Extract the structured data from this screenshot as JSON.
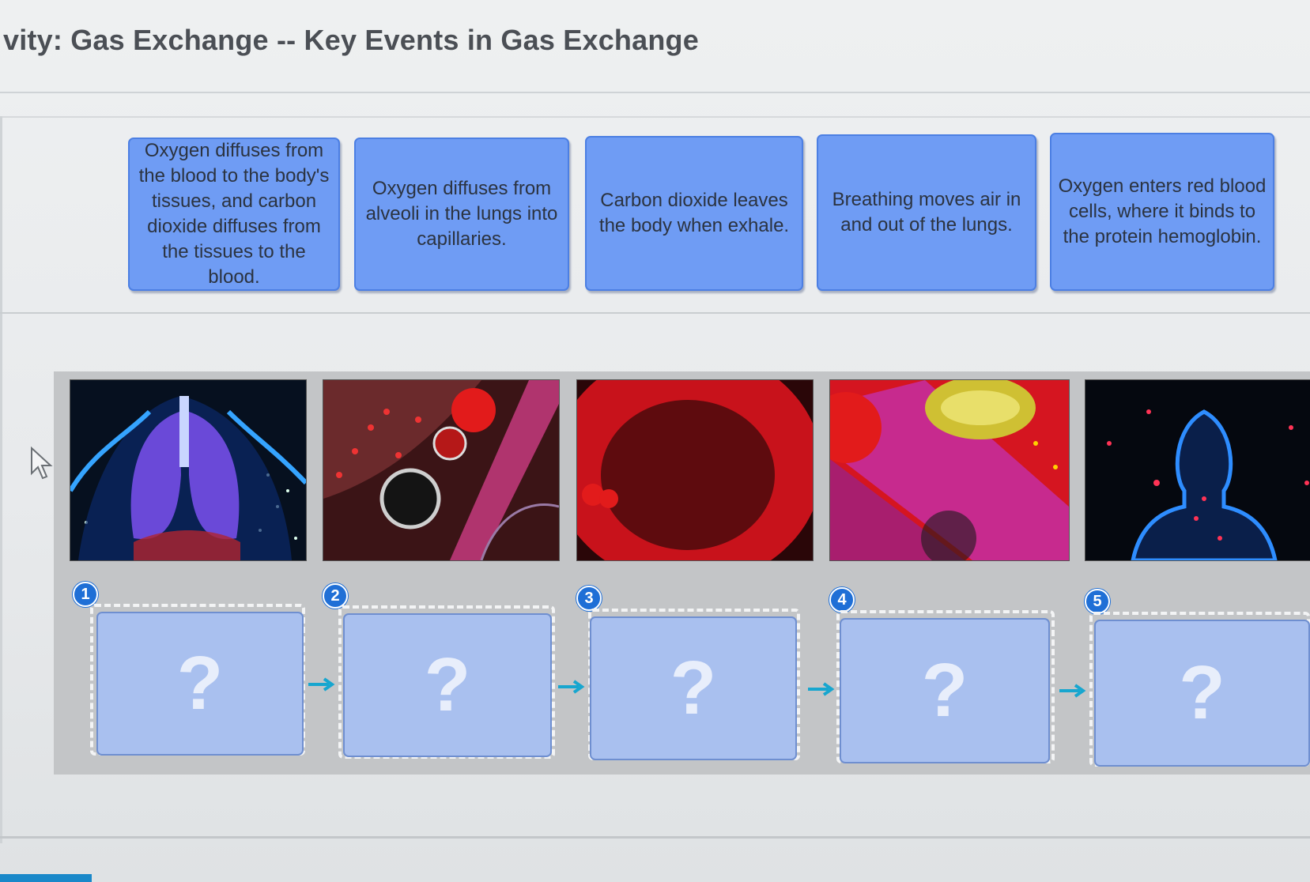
{
  "header": {
    "title": "vity: Gas Exchange -- Key Events in Gas Exchange"
  },
  "cards": [
    {
      "text": "Oxygen diffuses from the blood to the body's tissues, and carbon dioxide diffuses from the tissues to the blood."
    },
    {
      "text": "Oxygen diffuses from alveoli in the lungs into capillaries."
    },
    {
      "text": "Carbon dioxide leaves the body when exhale."
    },
    {
      "text": "Breathing moves air in and out of the lungs."
    },
    {
      "text": "Oxygen enters red blood cells, where it binds to the protein hemoglobin."
    }
  ],
  "steps": [
    {
      "number": "1",
      "placeholder": "?"
    },
    {
      "number": "2",
      "placeholder": "?"
    },
    {
      "number": "3",
      "placeholder": "?"
    },
    {
      "number": "4",
      "placeholder": "?"
    },
    {
      "number": "5",
      "placeholder": "?"
    }
  ],
  "colors": {
    "card_fill": "#6f9cf4",
    "card_border": "#4c7fe3",
    "slot_fill": "#a9c0ef",
    "badge": "#1f6fd6",
    "arrow": "#17a6cf"
  },
  "icons": {
    "cursor": "mouse-pointer-icon",
    "step_arrow": "arrow-right-icon"
  }
}
